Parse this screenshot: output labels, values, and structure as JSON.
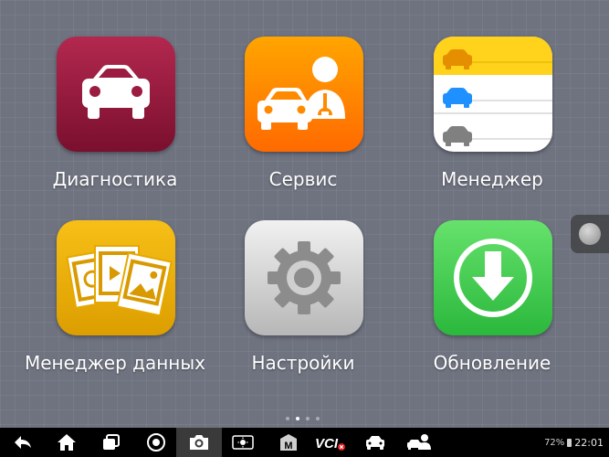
{
  "apps": [
    {
      "id": "diagnostics",
      "label": "Диагностика",
      "icon": "car-icon"
    },
    {
      "id": "service",
      "label": "Сервис",
      "icon": "car-mechanic-icon"
    },
    {
      "id": "manager",
      "label": "Менеджер",
      "icon": "car-list-icon"
    },
    {
      "id": "data_manager",
      "label": "Менеджер данных",
      "icon": "image-files-icon"
    },
    {
      "id": "settings",
      "label": "Настройки",
      "icon": "gear-icon"
    },
    {
      "id": "update",
      "label": "Обновление",
      "icon": "download-arrow-icon"
    }
  ],
  "page_indicator": {
    "count": 4,
    "active": 1
  },
  "taskbar": {
    "items": [
      "back-icon",
      "home-icon",
      "recent-apps-icon",
      "chrome-icon",
      "camera-icon",
      "brightness-icon",
      "maxifix-icon",
      "vci-icon",
      "car-icon",
      "car-user-icon"
    ],
    "vci_label": "VCI",
    "maxifix_label": "M"
  },
  "status": {
    "battery": "72%",
    "time": "22:01"
  },
  "colors": {
    "diagnostics": "#9c1c41",
    "service": "#ff8a00",
    "data_manager": "#efb00e",
    "update": "#3fcc4f",
    "settings": "#d9d9d9"
  }
}
